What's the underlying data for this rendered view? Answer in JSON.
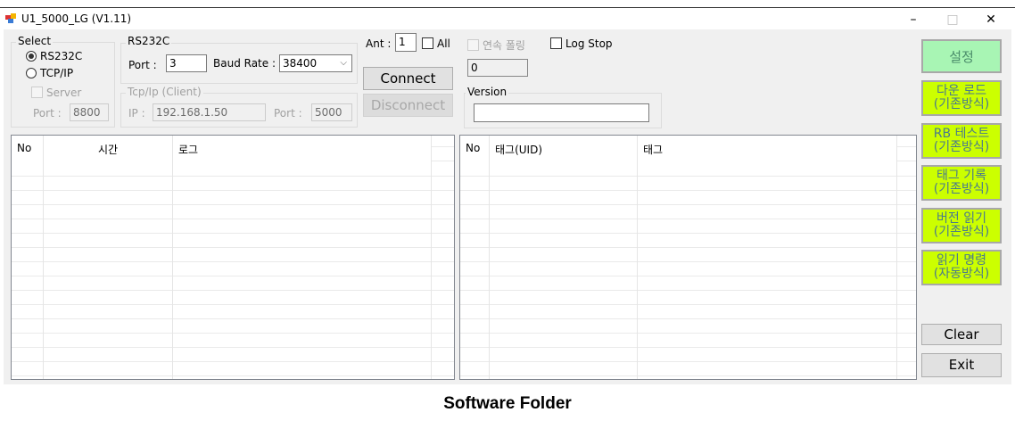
{
  "window": {
    "title": "U1_5000_LG (V1.11)",
    "minimize": "–",
    "maximize": "□",
    "close": "✕"
  },
  "select": {
    "label": "Select",
    "rs232c": "RS232C",
    "tcpip": "TCP/IP",
    "server": "Server",
    "port_label": "Port :",
    "port": "8800",
    "selected": "RS232C"
  },
  "rs232c": {
    "label": "RS232C",
    "port_label": "Port :",
    "port": "3",
    "baud_label": "Baud Rate :",
    "baud": "38400"
  },
  "tcp": {
    "label": "Tcp/Ip (Client)",
    "ip_label": "IP :",
    "ip": "192.168.1.50",
    "port_label": "Port :",
    "port": "5000"
  },
  "ant": {
    "label": "Ant :",
    "value": "1",
    "all": "All"
  },
  "buttons": {
    "connect": "Connect",
    "disconnect": "Disconnect",
    "clear": "Clear",
    "exit": "Exit",
    "settings": "설정",
    "green": [
      {
        "l1": "다운 로드",
        "l2": "(기존방식)"
      },
      {
        "l1": "RB 테스트",
        "l2": "(기존방식)"
      },
      {
        "l1": "태그 기록",
        "l2": "(기존방식)"
      },
      {
        "l1": "버전 읽기",
        "l2": "(기존방식)"
      },
      {
        "l1": "읽기 명령",
        "l2": "(자동방식)"
      }
    ]
  },
  "polling": {
    "label": "연속 폴링",
    "logstop": "Log Stop",
    "count": "0"
  },
  "version": {
    "label": "Version",
    "value": ""
  },
  "log_grid": {
    "columns": [
      "No",
      "시간",
      "로그"
    ]
  },
  "tag_grid": {
    "columns": [
      "No",
      "태그(UID)",
      "태그"
    ]
  },
  "caption": "Software Folder"
}
